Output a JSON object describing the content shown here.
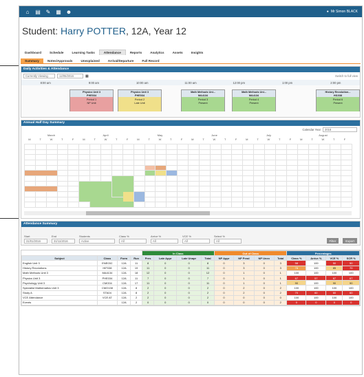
{
  "topbar": {
    "icons": [
      "home-icon",
      "calendar-icon",
      "edit-icon",
      "grid-icon",
      "people-icon"
    ],
    "user": "Mr Simon BLACK"
  },
  "student": {
    "prefix": "Student:",
    "name": "Harry POTTER",
    "suffix": ", 12A, Year 12"
  },
  "nav": [
    "Dashboard",
    "Schedule",
    "Learning Tasks",
    "Attendance",
    "Reports",
    "Analytics",
    "Assets",
    "Insights"
  ],
  "nav_active": "Attendance",
  "subnav": [
    "Summary",
    "Notes/Approvals",
    "Unexplained",
    "Arrival/Departure",
    "Full Record"
  ],
  "subnav_active": "Summary",
  "daily": {
    "title": "Daily Activities & Attendance",
    "view": "Currently Viewing",
    "date": "12/05/2016",
    "search": "Switch to full view",
    "times": [
      "8:00 am",
      "9:00 am",
      "10:00 am",
      "11:00 am",
      "12:00 pm",
      "1:00 pm",
      "2:00 pm"
    ],
    "lessons": [
      {
        "name": "Physics Unit 3",
        "code": "PHE034",
        "period": "Period 1",
        "status": "NP Unit",
        "color": "#e8a0a0"
      },
      {
        "name": "Physics Unit 3",
        "code": "PHE034",
        "period": "Period 2",
        "status": "Late Unit",
        "color": "#f0e08a"
      },
      {
        "name": "Math Methods Uni...",
        "code": "MA4134",
        "period": "Period 3",
        "status": "Present",
        "color": "#a8d890"
      },
      {
        "name": "Math Methods Uni...",
        "code": "MA4134",
        "period": "Period 4",
        "status": "Present",
        "color": "#a8d890"
      },
      {
        "name": "History Revolution...",
        "code": "HI1038",
        "period": "Period 6",
        "status": "Present",
        "color": "#a8d890"
      }
    ]
  },
  "halfday": {
    "title": "Annual Half Day Summary",
    "year_label": "Calendar Year",
    "year": "2016",
    "months": [
      "March",
      "April",
      "May",
      "June",
      "July",
      "August"
    ],
    "days": [
      "M",
      "T",
      "W",
      "T",
      "F"
    ]
  },
  "summary": {
    "title": "Attendance Summary",
    "fields": [
      {
        "label": "Start",
        "value": "31/01/2016"
      },
      {
        "label": "End",
        "value": "31/11/2016"
      },
      {
        "label": "Students",
        "value": "Active"
      },
      {
        "label": "Class %",
        "value": "All"
      },
      {
        "label": "Arrive %",
        "value": "All"
      },
      {
        "label": "VCE %",
        "value": "All"
      },
      {
        "label": "Select %",
        "value": "All"
      }
    ],
    "filter": "Filter",
    "export": "Export"
  },
  "table": {
    "groups": [
      "In Class",
      "Out of Class",
      "Percentages"
    ],
    "headers": [
      "Subject",
      "Class",
      "Form",
      "Run",
      "Pres",
      "Late Appr",
      "Late Unapr",
      "Total",
      "NP Appr",
      "NP Pend",
      "NP Unex",
      "Total",
      "Class %",
      "Arrive %",
      "VCE %",
      "SCR %"
    ],
    "rows": [
      [
        "English Unit 3",
        "ENE03C",
        "12A",
        "11",
        "8",
        "0",
        "0",
        "8",
        "0",
        "3",
        "0",
        "3",
        "58",
        "100",
        "50",
        "50"
      ],
      [
        "History Revolutions",
        "HIF038",
        "12A",
        "19",
        "11",
        "0",
        "0",
        "11",
        "0",
        "3",
        "0",
        "3",
        "78",
        "100",
        "85",
        "70"
      ],
      [
        "Math Methods Unit 3",
        "MA4134",
        "12A",
        "18",
        "12",
        "0",
        "0",
        "12",
        "0",
        "1",
        "0",
        "1",
        "100",
        "100",
        "100",
        "100"
      ],
      [
        "Physics Unit 3",
        "PHE034",
        "12A",
        "11",
        "7",
        "0",
        "0",
        "7",
        "0",
        "1",
        "0",
        "1",
        "67",
        "57",
        "67",
        "67"
      ],
      [
        "Psychology Unit 3",
        "CMO04",
        "12A",
        "17",
        "11",
        "0",
        "0",
        "11",
        "0",
        "1",
        "0",
        "1",
        "90",
        "100",
        "90",
        "90"
      ],
      [
        "Specialist Mathematics Unit 3",
        "CMO138",
        "12A",
        "8",
        "2",
        "0",
        "0",
        "2",
        "0",
        "2",
        "0",
        "2",
        "100",
        "100",
        "100",
        "100"
      ],
      [
        "Study A",
        "STA04",
        "12A",
        "8",
        "2",
        "0",
        "0",
        "2",
        "0",
        "2",
        "0",
        "2",
        "70",
        "60",
        "60",
        "60"
      ],
      [
        "VCE Attendance",
        "VCE AT",
        "12A",
        "2",
        "2",
        "0",
        "0",
        "2",
        "0",
        "0",
        "0",
        "0",
        "100",
        "100",
        "100",
        "100"
      ],
      [
        "Events",
        "",
        "12A",
        "2",
        "0",
        "0",
        "0",
        "0",
        "0",
        "0",
        "0",
        "2",
        "0",
        "0",
        "0",
        "0"
      ]
    ]
  },
  "colors": {
    "brand": "#1f5f8b",
    "accent": "#f08a2c",
    "present": "#a8d890",
    "late": "#f0e08a",
    "absent": "#e8a0a0"
  }
}
